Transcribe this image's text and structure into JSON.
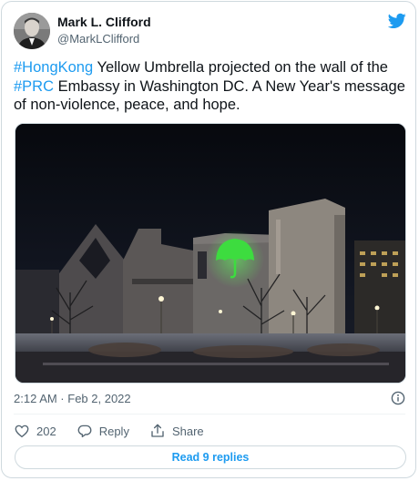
{
  "tweet": {
    "author_name": "Mark L. Clifford",
    "author_handle": "@MarkLClifford",
    "text": [
      {
        "kind": "hashtag",
        "text": "#HongKong"
      },
      {
        "kind": "plain",
        "text": " Yellow Umbrella projected on the wall of the "
      },
      {
        "kind": "hashtag",
        "text": "#PRC"
      },
      {
        "kind": "plain",
        "text": " Embassy in Washington DC. A New Year's message of non-violence, peace, and hope."
      }
    ],
    "timestamp": "2:12 AM · Feb 2, 2022"
  },
  "actions": {
    "like_count": "202",
    "reply_label": "Reply",
    "share_label": "Share"
  },
  "read_replies_label": "Read 9 replies",
  "icons": {
    "logo": "twitter-bird-icon",
    "info": "info-icon",
    "like": "heart-icon",
    "reply": "reply-icon",
    "share": "share-icon"
  },
  "colors": {
    "accent": "#1d9bf0",
    "text_primary": "#0f1419",
    "text_secondary": "#536471",
    "border": "#cfd9de",
    "projection_green": "#3ddc3f"
  }
}
